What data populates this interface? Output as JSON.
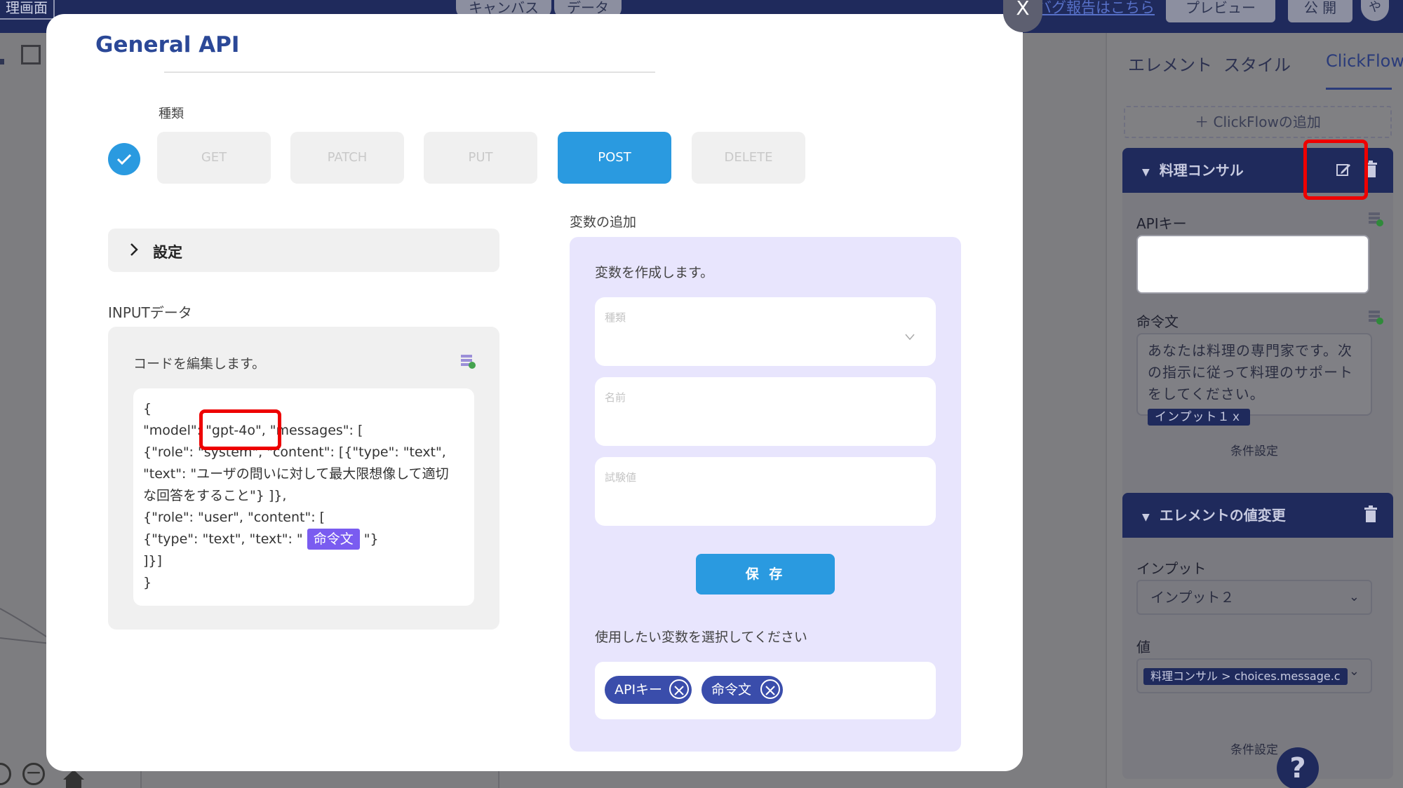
{
  "topbar": {
    "screen_tab": "理画面",
    "tabs": [
      "キャンバス",
      "データ"
    ],
    "close_glyph": "X",
    "bug_report_link": "バグ報告はこちら",
    "preview_button": "プレビュー",
    "publish_button": "公 開",
    "avatar_initial": "や"
  },
  "right_panel": {
    "tabs": [
      "エレメント",
      "スタイル",
      "ClickFlow"
    ],
    "active_tab": "ClickFlow",
    "add_flow": "＋ ClickFlowの追加",
    "flow1": {
      "title": "料理コンサル",
      "api_key_label": "APIキー",
      "prompt_label": "命令文",
      "prompt_text": "あなたは料理の専門家です。次の指示に従って料理のサポートをしてください。",
      "prompt_chip": "インプット１ｘ",
      "condition": "条件設定"
    },
    "flow2": {
      "title": "エレメントの値変更",
      "input_label": "インプット",
      "input_value": "インプット２",
      "value_label": "値",
      "value_chip": "料理コンサル > choices.message.c",
      "condition": "条件設定"
    },
    "help": "?"
  },
  "modal": {
    "title": "General API",
    "type_label": "種類",
    "methods": [
      "GET",
      "PATCH",
      "PUT",
      "POST",
      "DELETE"
    ],
    "active_method": "POST",
    "settings_label": "設定",
    "input_data_label": "INPUTデータ",
    "code_hint": "コードを編集します。",
    "code_lines": [
      "{",
      "\"model\": \"gpt-4o\", \"messages\": [",
      "{\"role\": \"system\", \"content\": [{\"type\": \"text\",",
      "\"text\": \"ユーザの問いに対して最大限想像して適切",
      "な回答をすること\"} ]},",
      "{\"role\": \"user\", \"content\": [",
      "{\"type\": \"text\", \"text\": \" ",
      "\"}",
      "]}]",
      "}"
    ],
    "code_chip": "命令文",
    "var_add_label": "変数の追加",
    "var_desc": "変数を作成します。",
    "var_type_placeholder": "種類",
    "var_name_placeholder": "名前",
    "var_test_placeholder": "試験値",
    "save_button": "保 存",
    "select_vars_label": "使用したい変数を選択してください",
    "selected_vars": [
      "APIキー",
      "命令文"
    ]
  },
  "colors": {
    "brand_navy": "#1f2a5c",
    "accent_blue": "#2a9ae0",
    "variable_chip_purple": "#7a5cf0",
    "highlight_red": "#ee0000",
    "var_panel_lavender": "#e8e5fd"
  }
}
